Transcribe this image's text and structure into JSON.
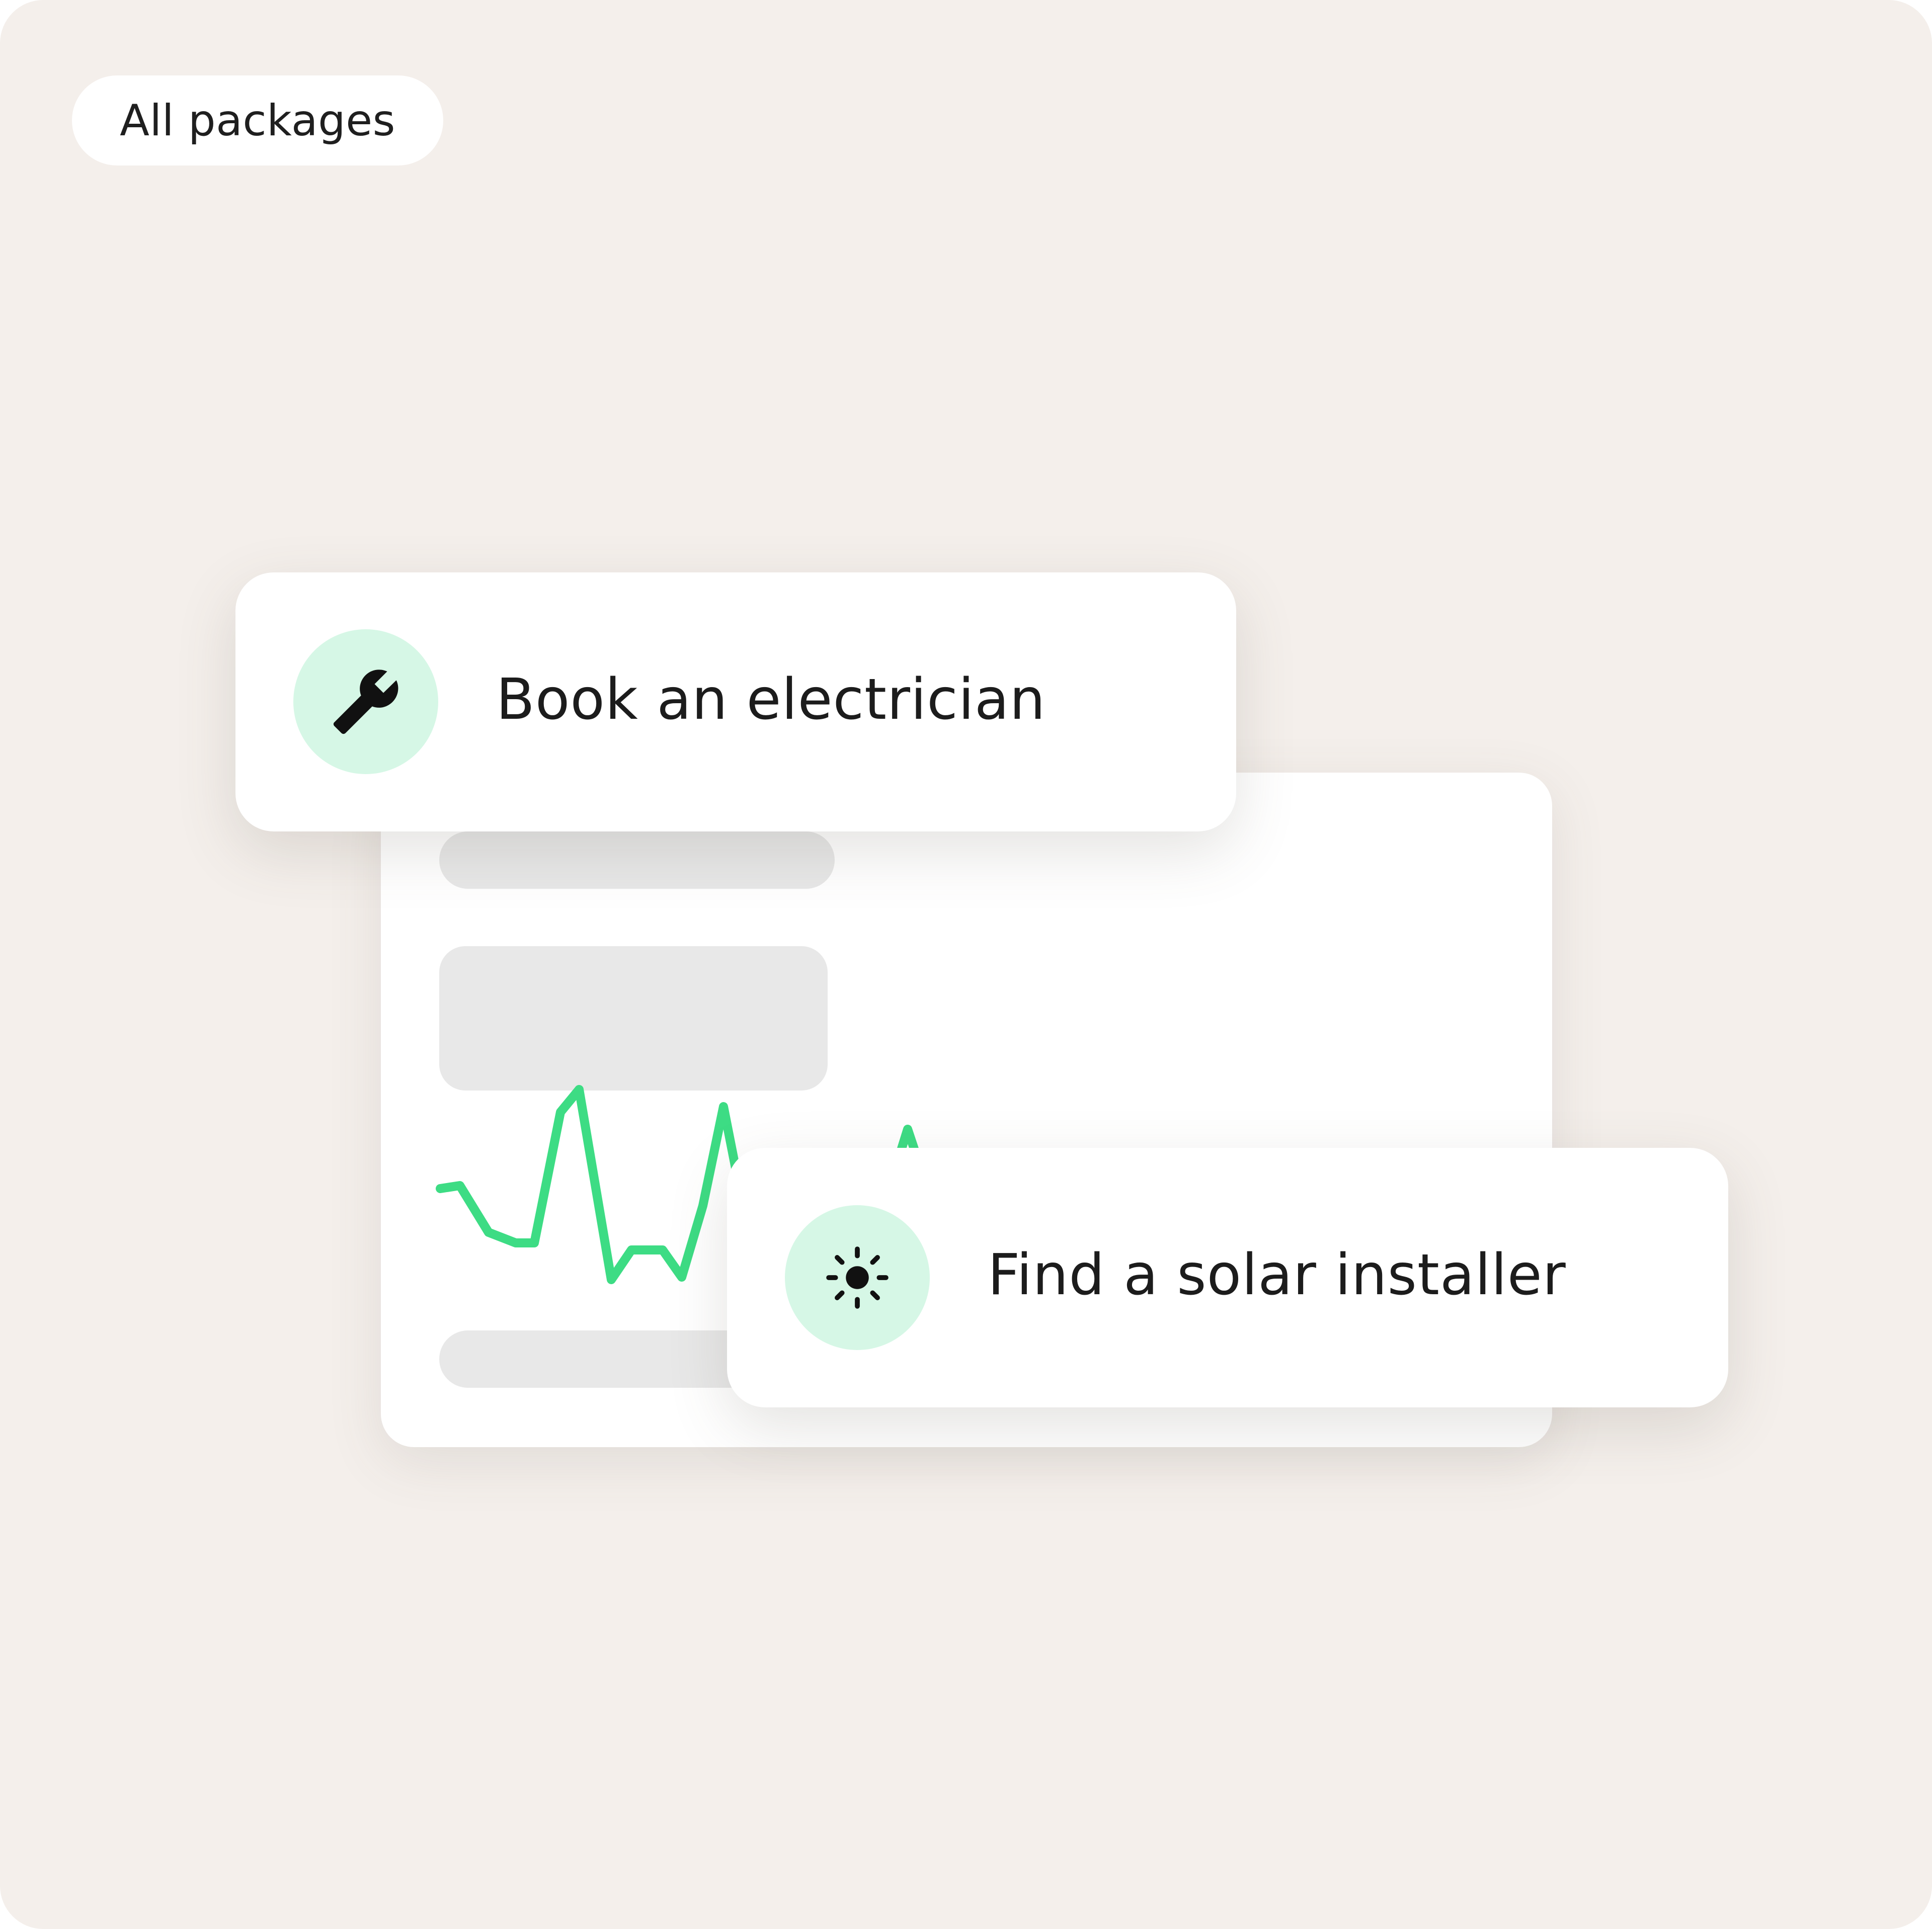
{
  "filter_pill": {
    "label": "All packages"
  },
  "actions": [
    {
      "label": "Book an electrician",
      "icon": "wrench-icon"
    },
    {
      "label": "Find a solar installer",
      "icon": "sun-icon"
    }
  ],
  "colors": {
    "background": "#f4efeb",
    "card": "#ffffff",
    "icon_circle": "#d6f7e6",
    "trend_line": "#3ddc84",
    "skeleton": "#e8e8e8",
    "text": "#1c1c1c"
  }
}
